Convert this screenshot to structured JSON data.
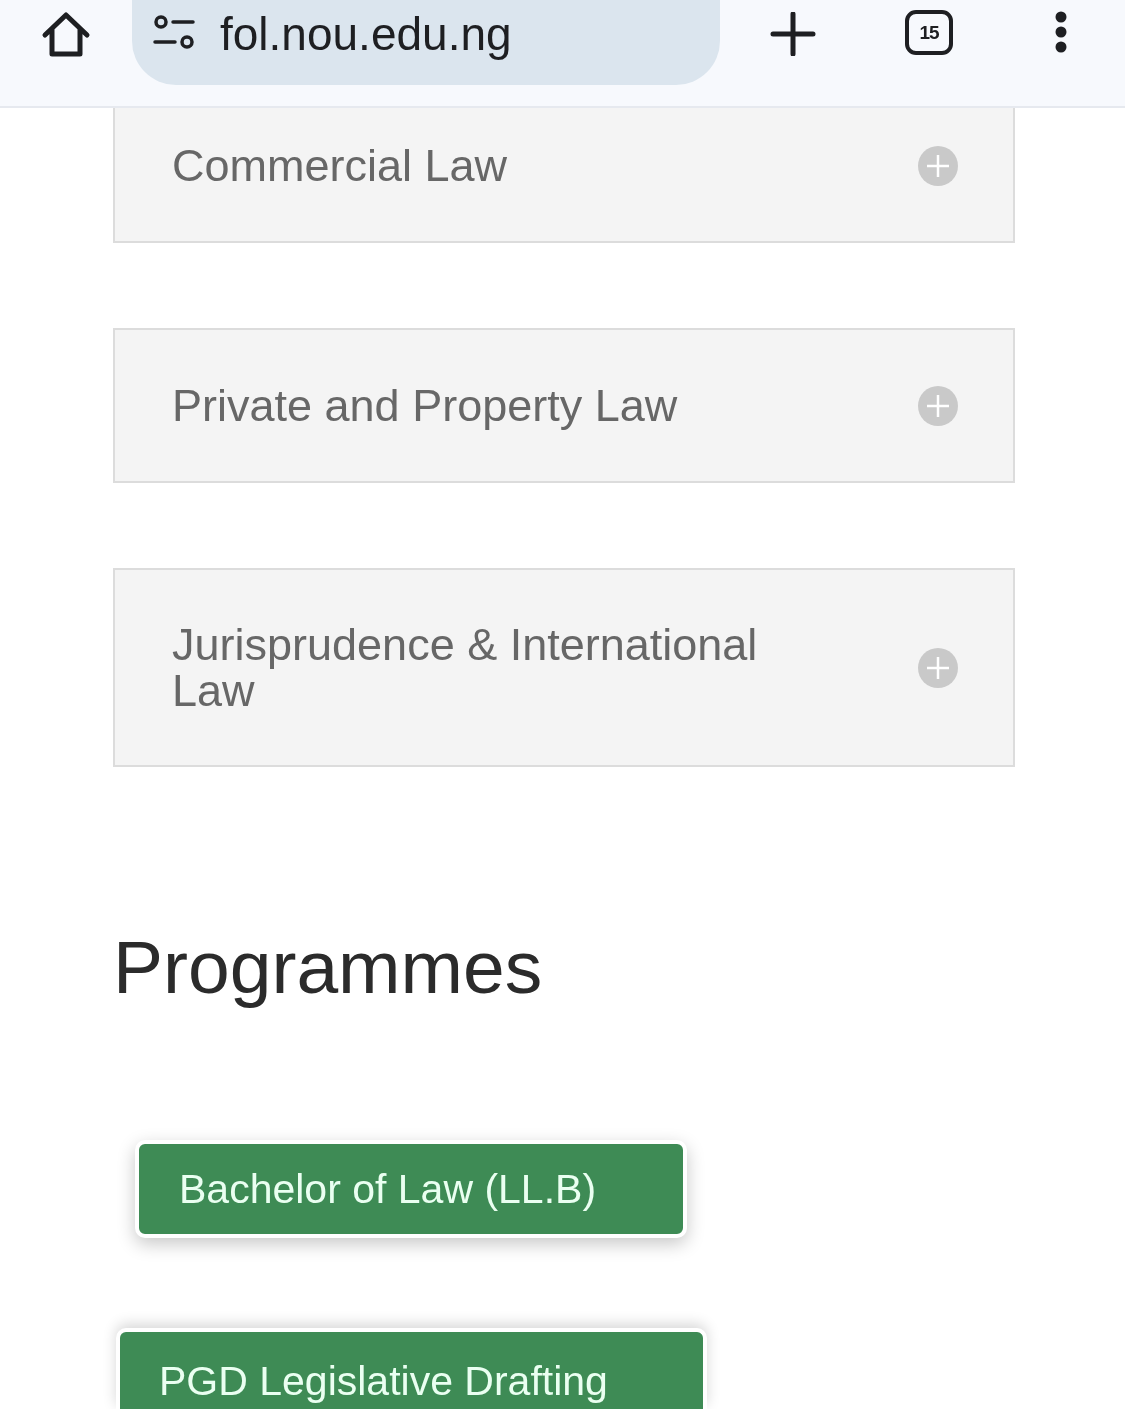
{
  "browser": {
    "url": "fol.nou.edu.ng",
    "tab_count": "15"
  },
  "accordion": [
    {
      "title": "Commercial Law",
      "expanded": false
    },
    {
      "title": "Private and Property Law",
      "expanded": false
    },
    {
      "title": "Jurisprudence & International Law",
      "expanded": false
    }
  ],
  "programmes": {
    "heading": "Programmes",
    "items": [
      "Bachelor of Law (LL.B)",
      "PGD Legislative Drafting"
    ]
  }
}
